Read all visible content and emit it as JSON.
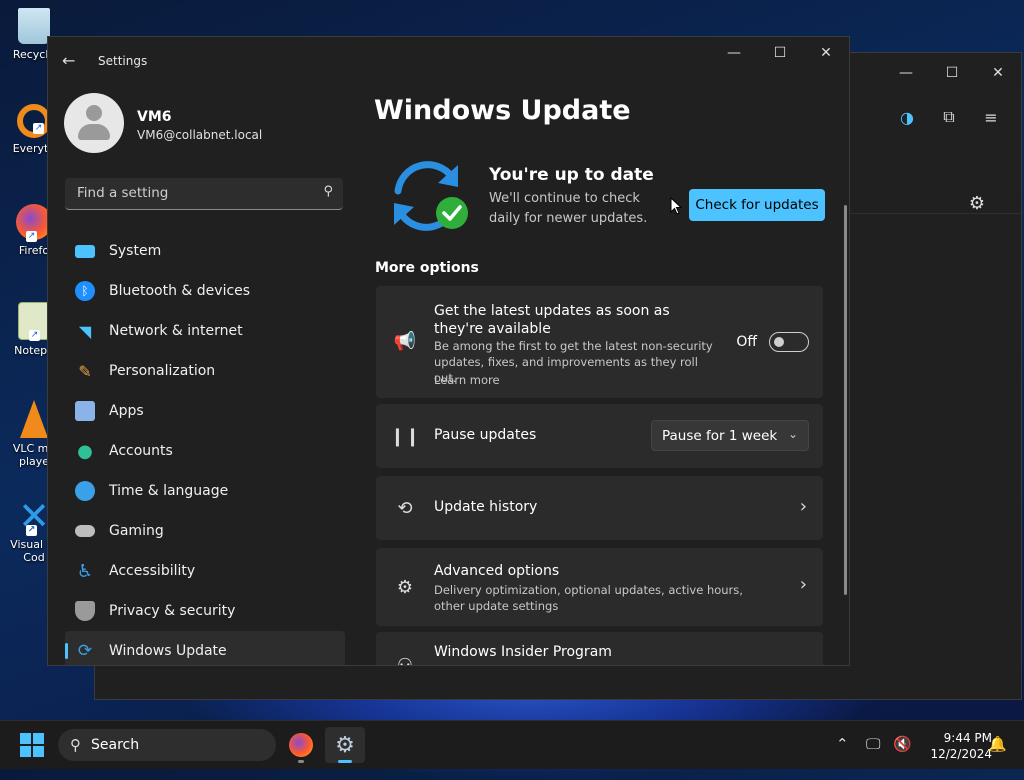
{
  "desktop": {
    "icons": [
      {
        "label": "Recycle"
      },
      {
        "label": "Everyth"
      },
      {
        "label": "Firefo"
      },
      {
        "label": "Notepa"
      },
      {
        "label": "VLC me playe"
      },
      {
        "label": "Visual St Cod"
      }
    ]
  },
  "background_window": {
    "caption": {
      "minimize": "—",
      "maximize": "☐",
      "close": "✕"
    },
    "tools": {
      "icon1": "◑",
      "icon2": "⧉",
      "menu": "≡"
    },
    "gear": "⚙"
  },
  "settings": {
    "title": "Settings",
    "caption": {
      "minimize": "—",
      "maximize": "☐",
      "close": "✕"
    },
    "profile": {
      "name": "VM6",
      "email": "VM6@collabnet.local"
    },
    "search": {
      "placeholder": "Find a setting"
    },
    "nav": [
      {
        "label": "System",
        "icon": "system-icon",
        "color": "#4cc2ff"
      },
      {
        "label": "Bluetooth & devices",
        "icon": "bluetooth-icon",
        "color": "#1f8fff"
      },
      {
        "label": "Network & internet",
        "icon": "wifi-icon",
        "color": "#4cc2ff"
      },
      {
        "label": "Personalization",
        "icon": "brush-icon",
        "color": "#e8a24a"
      },
      {
        "label": "Apps",
        "icon": "apps-icon",
        "color": "#8ab4e8"
      },
      {
        "label": "Accounts",
        "icon": "accounts-icon",
        "color": "#2fc09a"
      },
      {
        "label": "Time & language",
        "icon": "globe-icon",
        "color": "#3aa0e8"
      },
      {
        "label": "Gaming",
        "icon": "gamepad-icon",
        "color": "#bdbdbd"
      },
      {
        "label": "Accessibility",
        "icon": "accessibility-icon",
        "color": "#3aa0e8"
      },
      {
        "label": "Privacy & security",
        "icon": "shield-icon",
        "color": "#9a9a9a"
      },
      {
        "label": "Windows Update",
        "icon": "update-icon",
        "color": "#3aa0e8",
        "active": true
      }
    ],
    "page_title": "Windows Update",
    "status": {
      "title": "You're up to date",
      "subtitle": "We'll continue to check daily for newer updates."
    },
    "check_button": "Check for updates",
    "more_options": "More options",
    "cards": {
      "latest": {
        "title": "Get the latest updates as soon as they're available",
        "desc": "Be among the first to get the latest non-security updates, fixes, and improvements as they roll out.",
        "link": "Learn more",
        "toggle_label": "Off",
        "toggle_on": false
      },
      "pause": {
        "title": "Pause updates",
        "dropdown": "Pause for 1 week"
      },
      "history": {
        "title": "Update history"
      },
      "advanced": {
        "title": "Advanced options",
        "desc": "Delivery optimization, optional updates, active hours, other update settings"
      },
      "insider": {
        "title": "Windows Insider Program"
      }
    }
  },
  "taskbar": {
    "search_label": "Search",
    "time": "9:44 PM",
    "date": "12/2/2024",
    "accent": "#4cc2ff"
  }
}
